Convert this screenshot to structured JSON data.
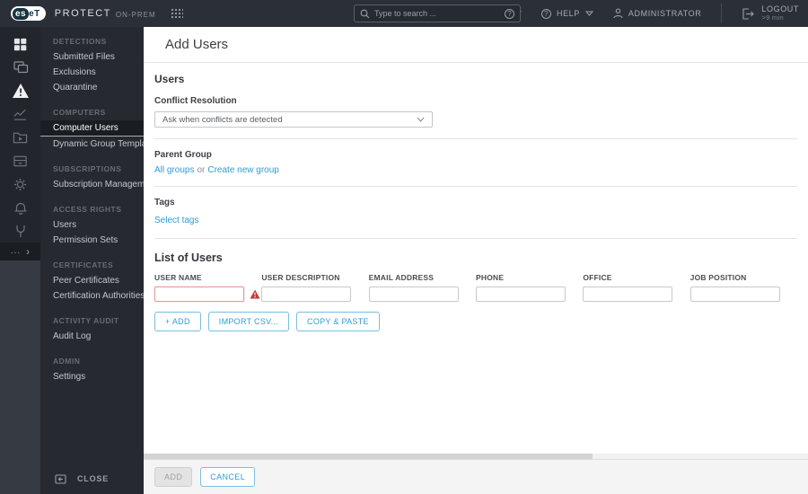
{
  "topbar": {
    "logo_left": "es",
    "logo_right": "eT",
    "product": "PROTECT",
    "product_suffix": "ON-PREM",
    "search_placeholder": "Type to search ...",
    "quick_links": "QUICK LINKS",
    "help": "HELP",
    "user": "ADMINISTRATOR",
    "logout": "LOGOUT",
    "logout_timer": ">9 min"
  },
  "icon_glyphs": {
    "help": "?",
    "more_dots": "...",
    "expand_chevron": "›"
  },
  "rail": {
    "icons": [
      "dashboard",
      "computers",
      "detections",
      "reports",
      "tasks",
      "installers",
      "policies",
      "notifications",
      "status",
      "more"
    ]
  },
  "sidebar": {
    "sections": [
      {
        "header": "DETECTIONS",
        "items": [
          {
            "label": "Submitted Files"
          },
          {
            "label": "Exclusions"
          },
          {
            "label": "Quarantine"
          }
        ]
      },
      {
        "header": "COMPUTERS",
        "items": [
          {
            "label": "Computer Users",
            "active": true
          },
          {
            "label": "Dynamic Group Templates"
          }
        ]
      },
      {
        "header": "SUBSCRIPTIONS",
        "items": [
          {
            "label": "Subscription Management"
          }
        ]
      },
      {
        "header": "ACCESS RIGHTS",
        "items": [
          {
            "label": "Users"
          },
          {
            "label": "Permission Sets"
          }
        ]
      },
      {
        "header": "CERTIFICATES",
        "items": [
          {
            "label": "Peer Certificates"
          },
          {
            "label": "Certification Authorities"
          }
        ]
      },
      {
        "header": "ACTIVITY AUDIT",
        "items": [
          {
            "label": "Audit Log"
          }
        ]
      },
      {
        "header": "ADMIN",
        "items": [
          {
            "label": "Settings"
          }
        ]
      }
    ],
    "close_label": "CLOSE"
  },
  "main": {
    "title": "Add Users",
    "users_section": {
      "heading": "Users",
      "conflict_label": "Conflict Resolution",
      "conflict_value": "Ask when conflicts are detected",
      "parent_group_label": "Parent Group",
      "all_groups_link": "All groups",
      "or_text": "or",
      "create_group_link": "Create new group",
      "tags_label": "Tags",
      "tags_link": "Select tags"
    },
    "list_section": {
      "heading": "List of Users",
      "columns": [
        {
          "label": "USER NAME",
          "field": "user-name",
          "error": true,
          "value": ""
        },
        {
          "label": "USER DESCRIPTION",
          "field": "user-description",
          "error": false,
          "value": ""
        },
        {
          "label": "EMAIL ADDRESS",
          "field": "email-address",
          "error": false,
          "value": ""
        },
        {
          "label": "PHONE",
          "field": "phone",
          "error": false,
          "value": ""
        },
        {
          "label": "OFFICE",
          "field": "office",
          "error": false,
          "value": ""
        },
        {
          "label": "JOB POSITION",
          "field": "job-position",
          "error": false,
          "value": ""
        }
      ],
      "add_button": "+ ADD",
      "import_button": "IMPORT CSV...",
      "copy_button": "COPY & PASTE"
    },
    "footer": {
      "add_button": "ADD",
      "cancel_button": "CANCEL"
    }
  },
  "colors": {
    "accent_blue": "#2f9cd6",
    "error_red": "#c23b33",
    "topbar_bg": "#2b3038",
    "rail_bg": "#22262c",
    "sidebar_bg": "#26292f"
  }
}
